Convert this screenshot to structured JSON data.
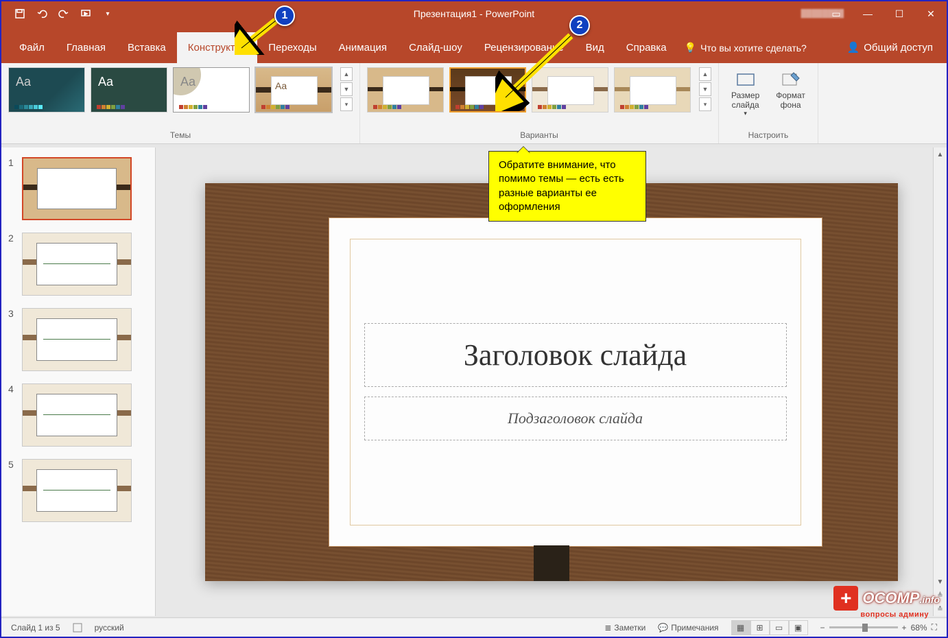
{
  "title": "Презентация1 - PowerPoint",
  "qat": {
    "save": "save",
    "undo": "undo",
    "redo": "redo",
    "start": "start-from-beginning"
  },
  "window": {
    "min": "—",
    "max": "☐",
    "close": "✕"
  },
  "tabs": {
    "file": "Файл",
    "home": "Главная",
    "insert": "Вставка",
    "design": "Конструктор",
    "transitions": "Переходы",
    "animations": "Анимация",
    "slideshow": "Слайд-шоу",
    "review": "Рецензирование",
    "view": "Вид",
    "help": "Справка"
  },
  "tellme_placeholder": "Что вы хотите сделать?",
  "share": "Общий доступ",
  "ribbon": {
    "themes_label": "Темы",
    "variants_label": "Варианты",
    "customize_label": "Настроить",
    "slide_size": "Размер\nслайда",
    "format_bg": "Формат\nфона"
  },
  "slides": {
    "count": 5,
    "numbers": [
      "1",
      "2",
      "3",
      "4",
      "5"
    ]
  },
  "slide_content": {
    "title": "Заголовок слайда",
    "subtitle": "Подзаголовок слайда"
  },
  "statusbar": {
    "slide_of": "Слайд 1 из 5",
    "lang": "русский",
    "notes": "Заметки",
    "comments": "Примечания",
    "zoom": "68%"
  },
  "annotations": {
    "m1": "1",
    "m2": "2",
    "callout": "Обратите внимание, что помимо темы — есть есть разные варианты ее оформления"
  },
  "watermark": {
    "brand": "OCOMP",
    "tld": ".info",
    "sub": "вопросы админу"
  }
}
